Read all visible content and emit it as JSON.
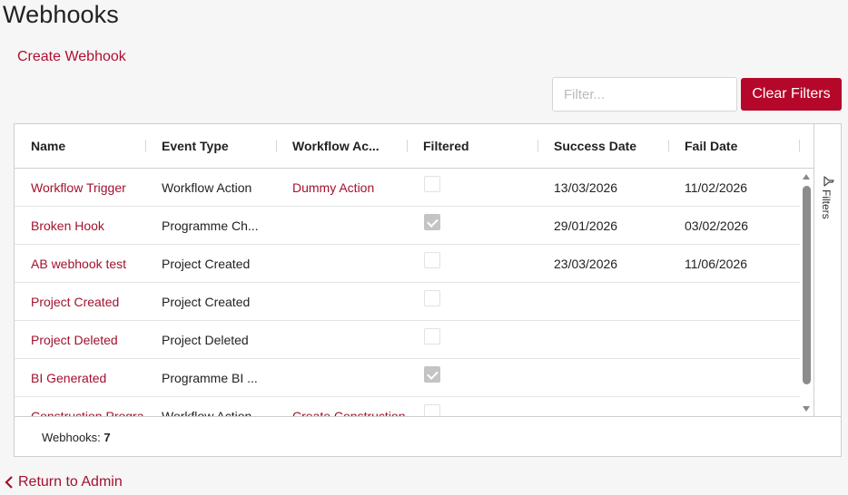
{
  "page": {
    "title": "Webhooks"
  },
  "actions": {
    "create_label": "Create Webhook"
  },
  "filter": {
    "placeholder": "Filter...",
    "value": "",
    "clear_label": "Clear Filters"
  },
  "grid": {
    "columns": [
      "Name",
      "Event Type",
      "Workflow Ac...",
      "Filtered",
      "Success Date",
      "Fail Date"
    ],
    "rows": [
      {
        "name": "Workflow Trigger",
        "event_type": "Workflow Action",
        "workflow_action": "Dummy Action",
        "filtered": false,
        "success_date": "13/03/2026",
        "fail_date": "11/02/2026"
      },
      {
        "name": "Broken Hook",
        "event_type": "Programme Ch...",
        "workflow_action": "",
        "filtered": true,
        "success_date": "29/01/2026",
        "fail_date": "03/02/2026"
      },
      {
        "name": "AB webhook test",
        "event_type": "Project Created",
        "workflow_action": "",
        "filtered": false,
        "success_date": "23/03/2026",
        "fail_date": "11/06/2026"
      },
      {
        "name": "Project Created",
        "event_type": "Project Created",
        "workflow_action": "",
        "filtered": false,
        "success_date": "",
        "fail_date": ""
      },
      {
        "name": "Project Deleted",
        "event_type": "Project Deleted",
        "workflow_action": "",
        "filtered": false,
        "success_date": "",
        "fail_date": ""
      },
      {
        "name": "BI Generated",
        "event_type": "Programme BI ...",
        "workflow_action": "",
        "filtered": true,
        "success_date": "",
        "fail_date": ""
      },
      {
        "name": "Construction Progra...",
        "event_type": "Workflow Action",
        "workflow_action": "Create Construction...",
        "filtered": false,
        "success_date": "",
        "fail_date": ""
      }
    ],
    "side_panel_label": "Filters",
    "footer": {
      "count_label": "Webhooks: ",
      "count_value": "7"
    }
  },
  "nav": {
    "return_label": "Return to Admin"
  },
  "colors": {
    "accent": "#b5072a",
    "link": "#a3112e"
  }
}
